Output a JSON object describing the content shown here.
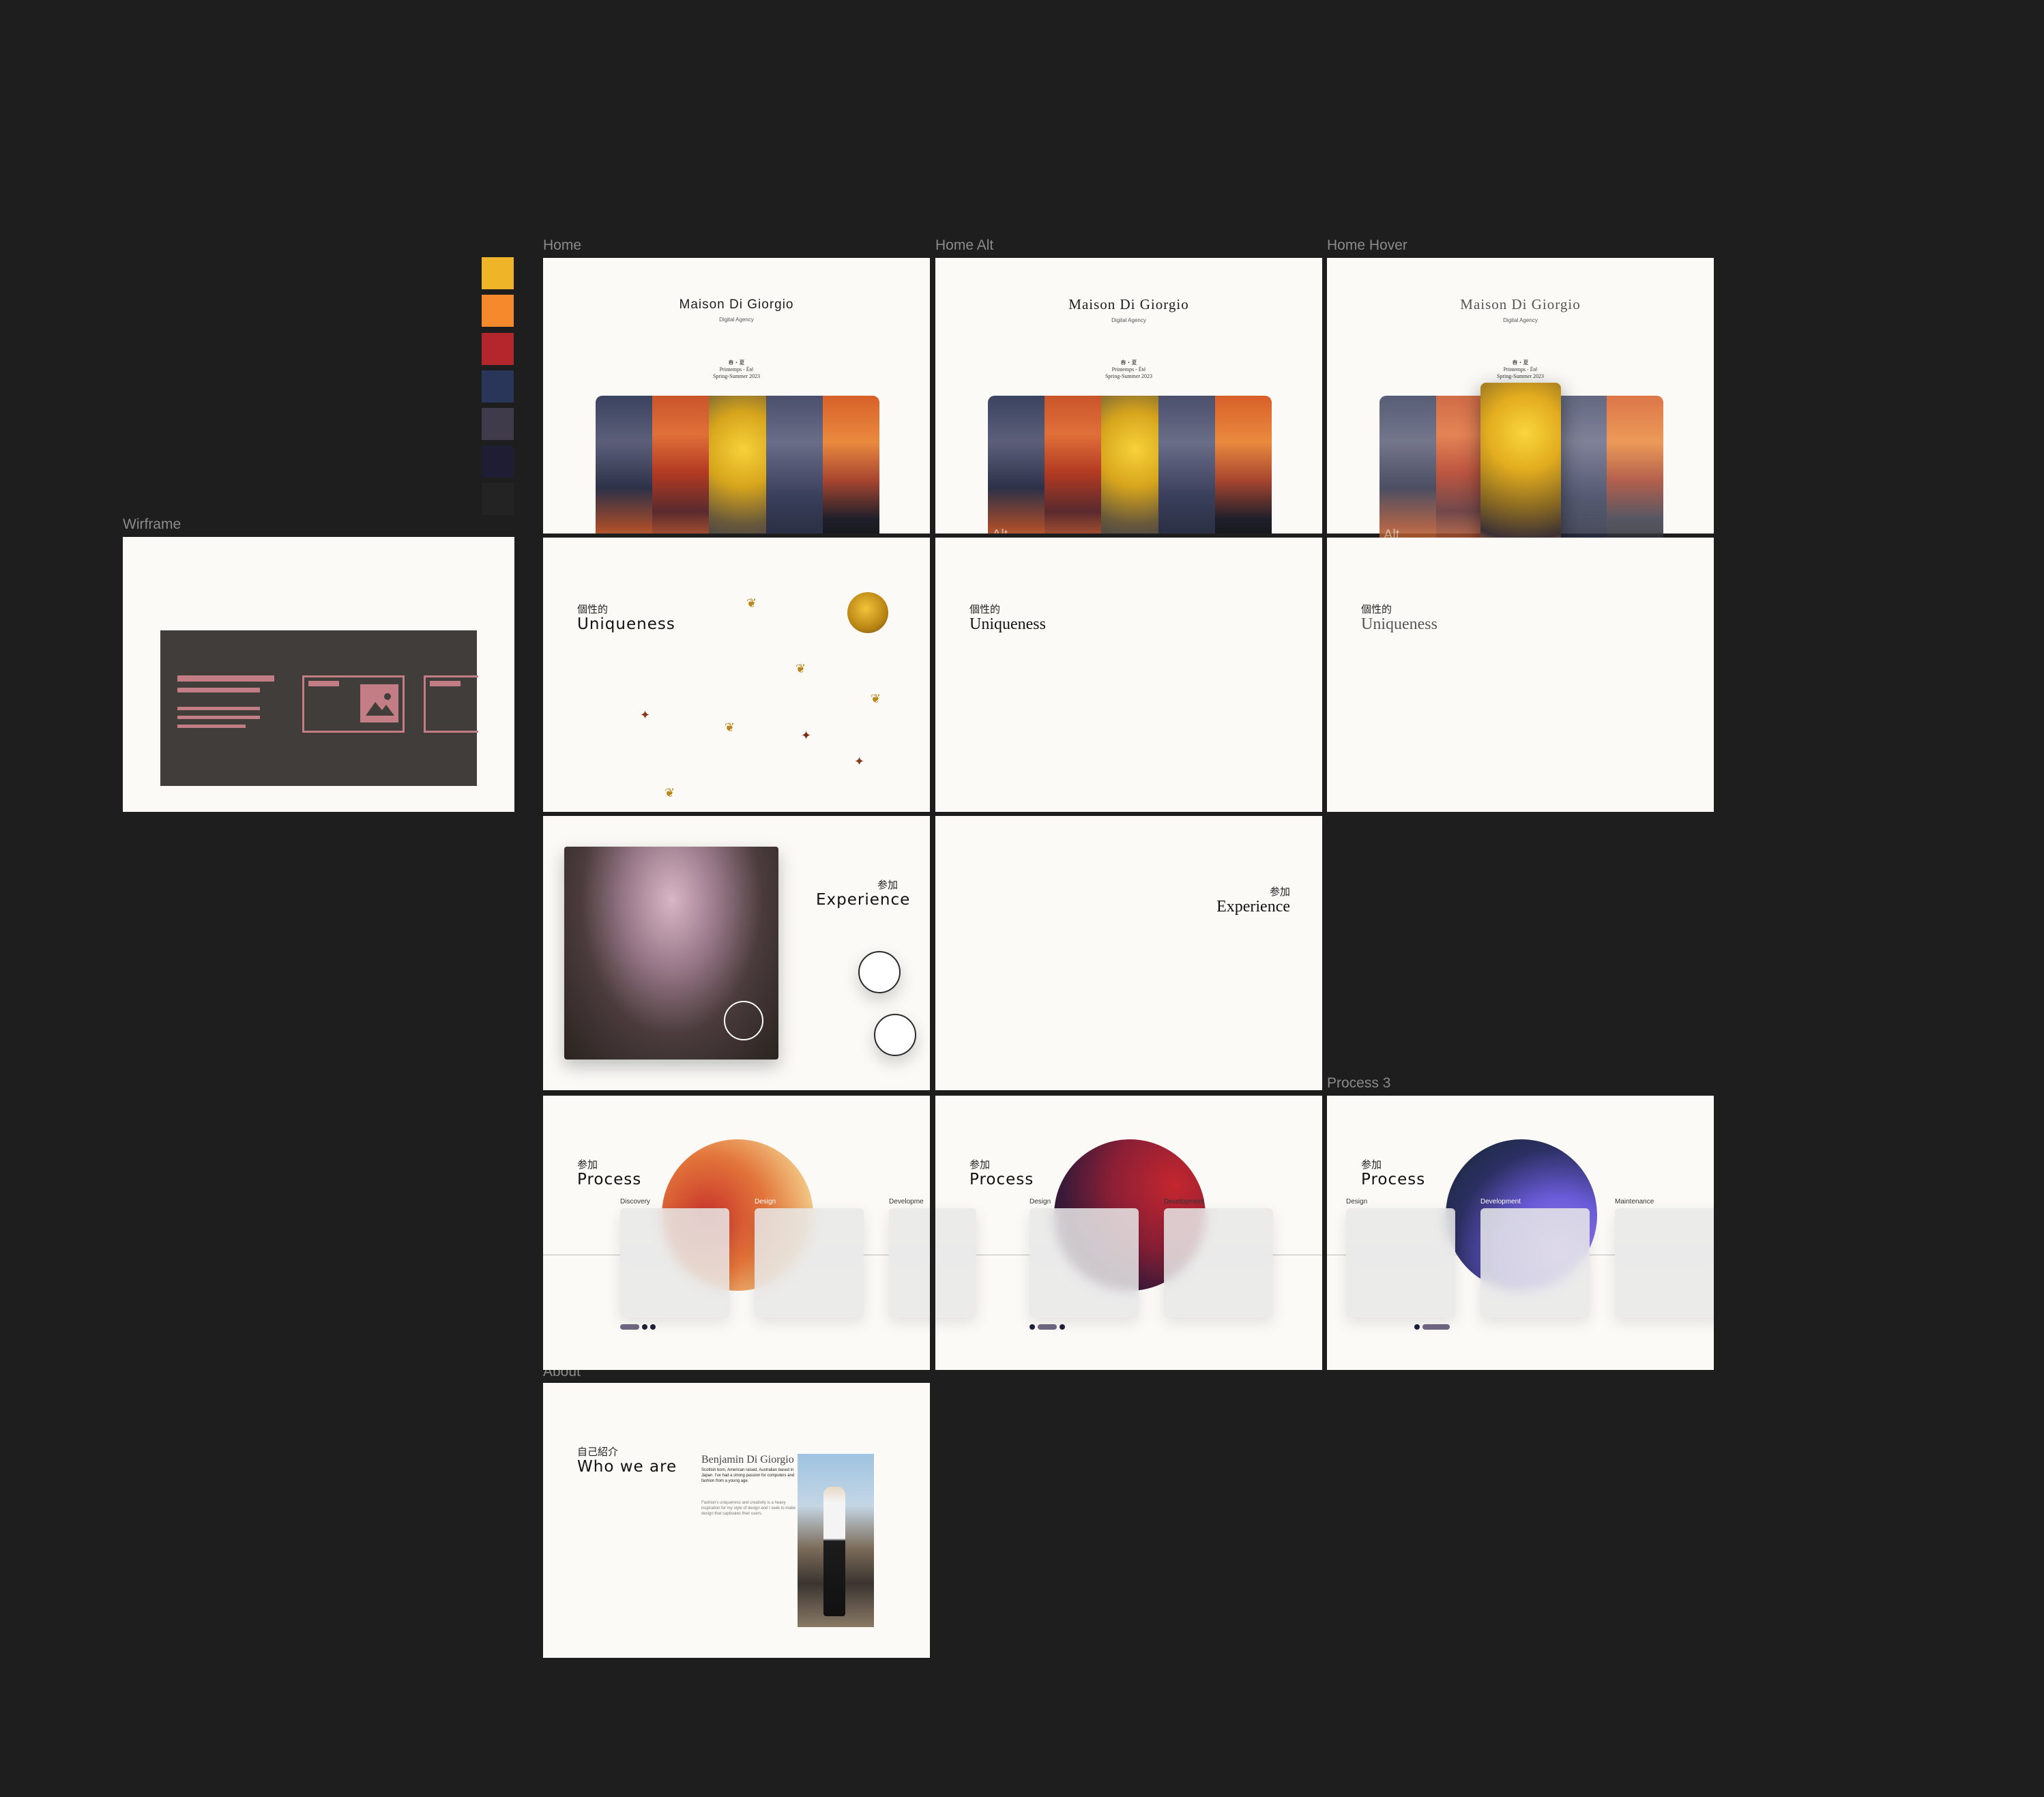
{
  "frame_labels": {
    "home": "Home",
    "home_alt": "Home Alt",
    "home_hover": "Home Hover",
    "wireframe": "Wirframe",
    "process3": "Process 3",
    "about": "About"
  },
  "palette": [
    "#f0b429",
    "#f58a2c",
    "#b3262c",
    "#2a3659",
    "#403b4b",
    "#1f1d33",
    "#232323"
  ],
  "home": {
    "brand": "Maison Di Giorgio",
    "subtitle": "Digital Agency",
    "season_jp": "春・夏",
    "season_fr": "Printemps - Été",
    "season_en": "Spring-Summer 2023",
    "alt_label": "Alt"
  },
  "uniqueness": {
    "kanji": "個性的",
    "title": "Uniqueness"
  },
  "experience": {
    "kanji": "参加",
    "title": "Experience"
  },
  "process": {
    "kanji": "参加",
    "title": "Process",
    "steps_1": [
      "Discovery",
      "Design",
      "Developme"
    ],
    "steps_2": [
      "Design",
      "Development"
    ],
    "steps_3": [
      "Design",
      "Development",
      "Maintenance"
    ]
  },
  "about": {
    "kanji": "自己紹介",
    "title": "Who we are",
    "name": "Benjamin Di Giorgio",
    "bio": "Scottish born, American raised, Australian based in Japan. I've had a strong passion for computers and fashion from a young age.",
    "bio2": "Fashion's uniqueness and creativity is a heavy inspiration for my style of design and I seek to make design that captivates their users."
  }
}
